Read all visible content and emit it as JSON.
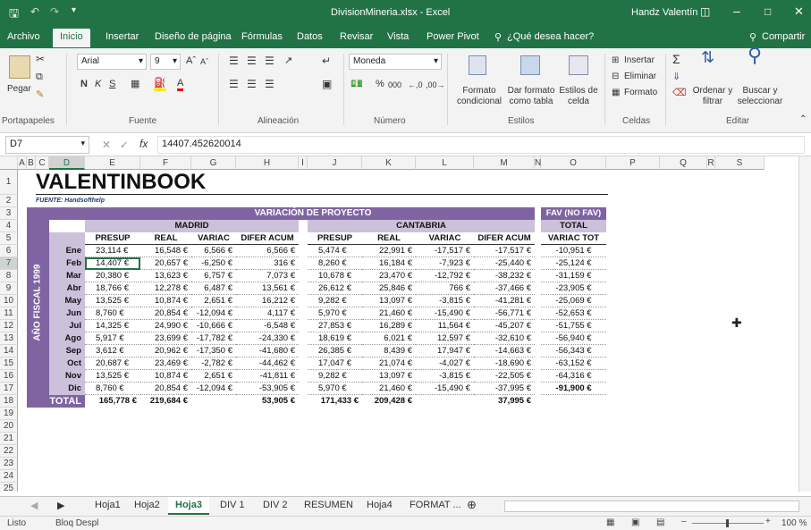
{
  "window": {
    "title": "DivisionMineria.xlsx - Excel",
    "user": "Handz Valentín"
  },
  "tabs": [
    "Archivo",
    "Inicio",
    "Insertar",
    "Diseño de página",
    "Fórmulas",
    "Datos",
    "Revisar",
    "Vista",
    "Power Pivot"
  ],
  "tellme": "¿Qué desea hacer?",
  "share": "Compartir",
  "ribbon": {
    "clipboard": {
      "paste": "Pegar",
      "label": "Portapapeles"
    },
    "font": {
      "name": "Arial",
      "size": "9",
      "label": "Fuente"
    },
    "alignment": {
      "label": "Alineación"
    },
    "number": {
      "format": "Moneda",
      "percent": "%",
      "thousands": "000",
      "label": "Número"
    },
    "styles": {
      "conditional": "Formato condicional",
      "astable": "Dar formato como tabla",
      "cellstyles": "Estilos de celda",
      "label": "Estilos"
    },
    "cells": {
      "insert": "Insertar",
      "delete": "Eliminar",
      "format": "Formato",
      "label": "Celdas"
    },
    "editing": {
      "sort": "Ordenar y filtrar",
      "find": "Buscar y seleccionar",
      "label": "Editar"
    }
  },
  "formula": {
    "namebox": "D7",
    "value": "14407.452620014"
  },
  "columns": [
    "A",
    "B",
    "C",
    "D",
    "E",
    "F",
    "G",
    "H",
    "I",
    "J",
    "K",
    "L",
    "M",
    "N",
    "O",
    "P",
    "Q",
    "R",
    "S"
  ],
  "rows": [
    "1",
    "2",
    "3",
    "4",
    "5",
    "6",
    "7",
    "8",
    "9",
    "10",
    "11",
    "12",
    "13",
    "14",
    "15",
    "16",
    "17",
    "18",
    "19",
    "20",
    "21",
    "22",
    "23",
    "24",
    "25"
  ],
  "report": {
    "title": "VALENTINBOOK",
    "source": "FUENTE: Handsofthelp",
    "main_header": "VARIACIÓN DE PROYECTO",
    "madrid": "MADRID",
    "cantabria": "CANTABRIA",
    "fav_header": "FAV (NO FAV)",
    "total_header": "TOTAL",
    "variac_tot": "VARIAC TOT",
    "year_label": "AÑO FISCAL 1999",
    "col_headers": [
      "PRESUP",
      "REAL",
      "VARIAC",
      "DIFER ACUM"
    ],
    "months": [
      "Ene",
      "Feb",
      "Mar",
      "Abr",
      "May",
      "Jun",
      "Jul",
      "Ago",
      "Sep",
      "Oct",
      "Nov",
      "Dic"
    ],
    "madrid_rows": [
      [
        "23,114 €",
        "16,548 €",
        "6,566 €",
        "6,566 €"
      ],
      [
        "14,407 €",
        "20,657 €",
        "-6,250 €",
        "316 €"
      ],
      [
        "20,380 €",
        "13,623 €",
        "6,757 €",
        "7,073 €"
      ],
      [
        "18,766 €",
        "12,278 €",
        "6,487 €",
        "13,561 €"
      ],
      [
        "13,525 €",
        "10,874 €",
        "2,651 €",
        "16,212 €"
      ],
      [
        "8,760 €",
        "20,854 €",
        "-12,094 €",
        "4,117 €"
      ],
      [
        "14,325 €",
        "24,990 €",
        "-10,666 €",
        "-6,548 €"
      ],
      [
        "5,917 €",
        "23,699 €",
        "-17,782 €",
        "-24,330 €"
      ],
      [
        "3,612 €",
        "20,962 €",
        "-17,350 €",
        "-41,680 €"
      ],
      [
        "20,687 €",
        "23,469 €",
        "-2,782 €",
        "-44,462 €"
      ],
      [
        "13,525 €",
        "10,874 €",
        "2,651 €",
        "-41,811 €"
      ],
      [
        "8,760 €",
        "20,854 €",
        "-12,094 €",
        "-53,905 €"
      ]
    ],
    "cantabria_rows": [
      [
        "5,474 €",
        "22,991 €",
        "-17,517 €",
        "-17,517 €"
      ],
      [
        "8,260 €",
        "16,184 €",
        "-7,923 €",
        "-25,440 €"
      ],
      [
        "10,678 €",
        "23,470 €",
        "-12,792 €",
        "-38,232 €"
      ],
      [
        "26,612 €",
        "25,846 €",
        "766 €",
        "-37,466 €"
      ],
      [
        "9,282 €",
        "13,097 €",
        "-3,815 €",
        "-41,281 €"
      ],
      [
        "5,970 €",
        "21,460 €",
        "-15,490 €",
        "-56,771 €"
      ],
      [
        "27,853 €",
        "16,289 €",
        "11,564 €",
        "-45,207 €"
      ],
      [
        "18,619 €",
        "6,021 €",
        "12,597 €",
        "-32,610 €"
      ],
      [
        "26,385 €",
        "8,439 €",
        "17,947 €",
        "-14,663 €"
      ],
      [
        "17,047 €",
        "21,074 €",
        "-4,027 €",
        "-18,690 €"
      ],
      [
        "9,282 €",
        "13,097 €",
        "-3,815 €",
        "-22,505 €"
      ],
      [
        "5,970 €",
        "21,460 €",
        "-15,490 €",
        "-37,995 €"
      ]
    ],
    "fav_rows": [
      "-10,951 €",
      "-25,124 €",
      "-31,159 €",
      "-23,905 €",
      "-25,069 €",
      "-52,653 €",
      "-51,755 €",
      "-56,940 €",
      "-56,343 €",
      "-63,152 €",
      "-64,316 €",
      "-91,900 €"
    ],
    "total_label": "TOTAL",
    "totals": {
      "m_presup": "165,778 €",
      "m_real": "219,684 €",
      "m_difer": "53,905 €",
      "c_presup": "171,433 €",
      "c_real": "209,428 €",
      "c_difer": "37,995 €"
    }
  },
  "sheets": [
    "Hoja1",
    "Hoja2",
    "Hoja3",
    "DIV 1",
    "DIV 2",
    "RESUMEN",
    "Hoja4",
    "FORMAT ..."
  ],
  "active_sheet": "Hoja3",
  "status": {
    "ready": "Listo",
    "scroll": "Bloq Despl",
    "zoom": "100 %"
  }
}
